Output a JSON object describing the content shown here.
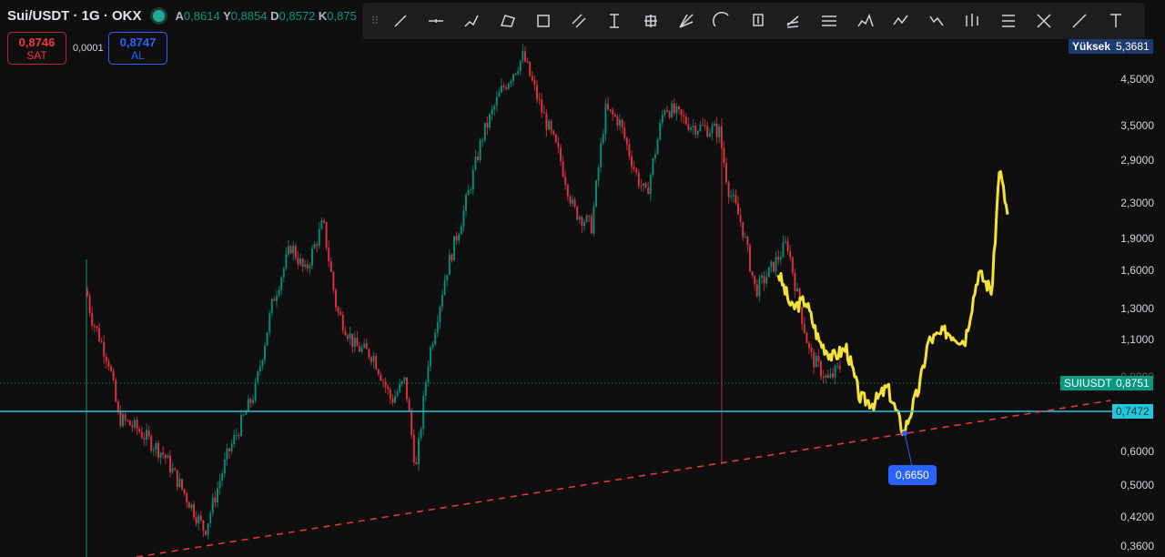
{
  "header": {
    "symbol": "Sui/USDT · 1G · OKX",
    "open_label": "A",
    "open": "0,8614",
    "high_label": "Y",
    "high": "0,8854",
    "low_label": "D",
    "low": "0,8572",
    "close_label": "K",
    "close": "0,875"
  },
  "trade": {
    "sell_price": "0,8746",
    "sell_label": "SAT",
    "spread": "0,0001",
    "buy_price": "0,8747",
    "buy_label": "AL"
  },
  "toolbar": {
    "icons": [
      "trend-line-icon",
      "horizontal-ray-icon",
      "path-icon",
      "polyline-icon",
      "rectangle-icon",
      "parallel-channel-icon",
      "price-range-icon",
      "date-price-range-icon",
      "fib-fan-icon",
      "arc-icon",
      "price-label-icon",
      "pitchfork-icon",
      "fib-retracement-icon",
      "head-shoulders-icon",
      "xabcd-pattern-icon",
      "elliott-wave-icon",
      "bars-pattern-icon",
      "gann-box-icon",
      "cypher-pattern-icon",
      "ray-icon",
      "text-icon"
    ]
  },
  "axis": {
    "high_label": "Yüksek",
    "high_value": "5,3681",
    "ticks": [
      "4,5000",
      "3,5000",
      "2,9000",
      "2,3000",
      "1,9000",
      "1,6000",
      "1,3000",
      "1,1000",
      "0,9000",
      "0,6000",
      "0,5000",
      "0,4200",
      "0,3600"
    ],
    "symbol_tag": "SUIUSDT",
    "last_price": "0,8751",
    "hline_price": "0,7472"
  },
  "annotation": {
    "low_label": "0,6650"
  },
  "colors": {
    "up": "#089981",
    "down": "#f23645",
    "overlay": "#f5e13a",
    "hline": "#26c6da",
    "trend": "#f23645"
  },
  "chart_data": {
    "type": "candlestick",
    "scale": "log",
    "ylim": [
      0.36,
      5.3681
    ],
    "main_series_keypoints": [
      1.43,
      1.25,
      0.97,
      0.72,
      0.68,
      0.59,
      0.49,
      0.39,
      0.59,
      0.83,
      1.36,
      1.83,
      1.58,
      2.07,
      1.29,
      1.06,
      1.01,
      0.79,
      0.88,
      0.54,
      0.97,
      1.58,
      2.22,
      3.3,
      4.2,
      5.1,
      3.8,
      2.95,
      2.22,
      2.03,
      3.8,
      3.6,
      2.65,
      2.39,
      3.9,
      3.5,
      3.4,
      2.5,
      2.05,
      1.43,
      1.58,
      1.86,
      1.43,
      1.01,
      0.88,
      0.96
    ],
    "overlay_series_keypoints": [
      1.58,
      1.3,
      1.36,
      1.09,
      1.0,
      1.05,
      0.8,
      0.78,
      0.85,
      0.665,
      0.85,
      1.09,
      1.15,
      1.09,
      1.58,
      1.43,
      2.8,
      2.1
    ],
    "horizontal_line": 0.7472,
    "last_price": 0.8751,
    "marked_low": 0.665
  }
}
